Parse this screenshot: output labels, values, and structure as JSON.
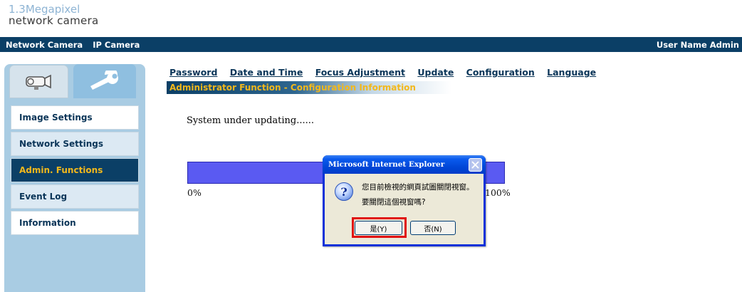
{
  "logo": {
    "line1": "1.3Megapixel",
    "line2": "network camera"
  },
  "topbar": {
    "left": [
      "Network Camera",
      "IP Camera"
    ],
    "user": "User Name Admin"
  },
  "tabs": {
    "camera": "camera-icon",
    "tools": "wrench-icon"
  },
  "menu": [
    {
      "label": "Image Settings",
      "state": "normal"
    },
    {
      "label": "Network Settings",
      "state": "shaded"
    },
    {
      "label": "Admin. Functions",
      "state": "active"
    },
    {
      "label": "Event Log",
      "state": "shaded"
    },
    {
      "label": "Information",
      "state": "normal"
    }
  ],
  "nav_links": [
    "Password",
    "Date and Time",
    "Focus Adjustment",
    "Update",
    "Configuration",
    "Language"
  ],
  "section_title": "Administrator Function - Configuration Information",
  "status": "System under updating......",
  "progress": {
    "start_label": "0%",
    "end_label": "100%"
  },
  "dialog": {
    "title": "Microsoft Internet Explorer",
    "line1": "您目前檢視的網頁試圖關閉視窗。",
    "line2": "要關閉這個視窗嗎?",
    "yes": "是(Y)",
    "no": "否(N)"
  },
  "colors": {
    "header": "#0b3f66",
    "accent": "#f2b81c",
    "progress": "#5a5af2",
    "highlight": "#e01010"
  }
}
